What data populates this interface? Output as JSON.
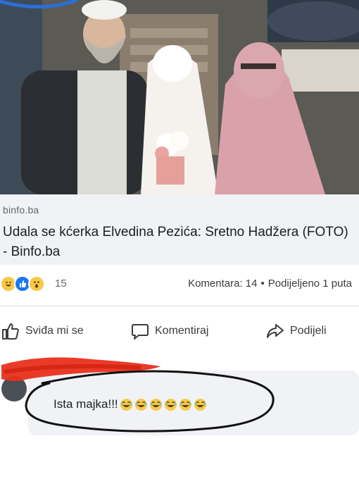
{
  "link_preview": {
    "domain": "binfo.ba",
    "title": "Udala se kćerka Elvedina Pezića: Sretno Hadžera (FOTO) - Binfo.ba"
  },
  "reactions": {
    "icons": [
      "haha-icon",
      "like-icon",
      "wow-icon"
    ],
    "count": "15",
    "comments": "Komentara: 14",
    "separator": "•",
    "shares": "Podijeljeno 1 puta"
  },
  "actions": {
    "like": "Sviđa mi se",
    "comment": "Komentiraj",
    "share": "Podijeli"
  },
  "comment": {
    "text": "Ista majka!!!",
    "emoji": "laughing-emoji",
    "emoji_count": 6
  },
  "colors": {
    "facebook_blue": "#1877f2",
    "annotation_red": "#e8301c",
    "text_secondary": "#65676b"
  }
}
